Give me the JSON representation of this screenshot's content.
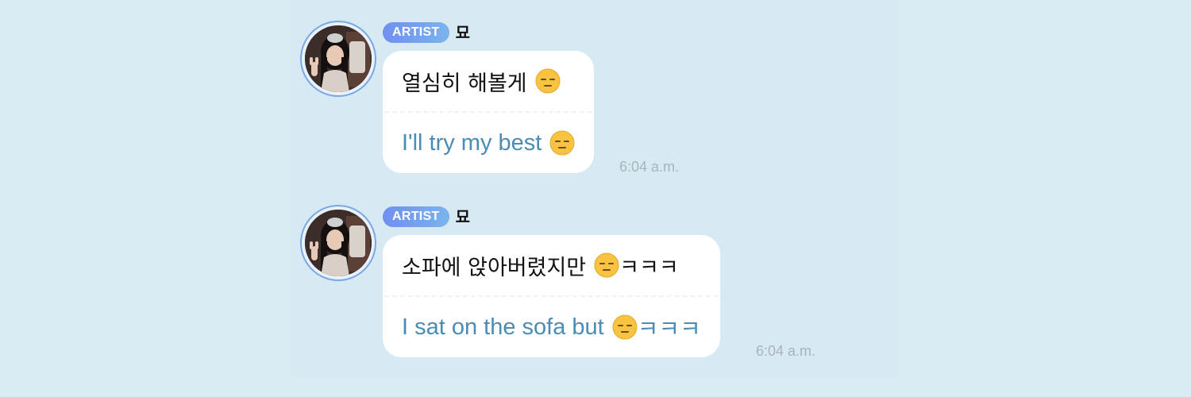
{
  "messages": [
    {
      "badge": "ARTIST",
      "sender": "묘",
      "original_text": "열심히 해볼게",
      "original_suffix": "",
      "translation_text": "I'll try my best",
      "translation_suffix": "",
      "emoji": "expressionless-face-icon",
      "time": "6:04 a.m."
    },
    {
      "badge": "ARTIST",
      "sender": "묘",
      "original_text": "소파에 앉아버렸지만",
      "original_suffix": "ㅋㅋㅋ",
      "translation_text": "I sat on the sofa but",
      "translation_suffix": "ㅋㅋㅋ",
      "emoji": "expressionless-face-icon",
      "time": "6:04 a.m."
    }
  ],
  "colors": {
    "background": "#d9ecf4",
    "badge_gradient_start": "#6f8ff0",
    "badge_gradient_end": "#7bb4ee",
    "translation_text": "#4a8cb6",
    "timestamp": "#a9b4ba"
  }
}
